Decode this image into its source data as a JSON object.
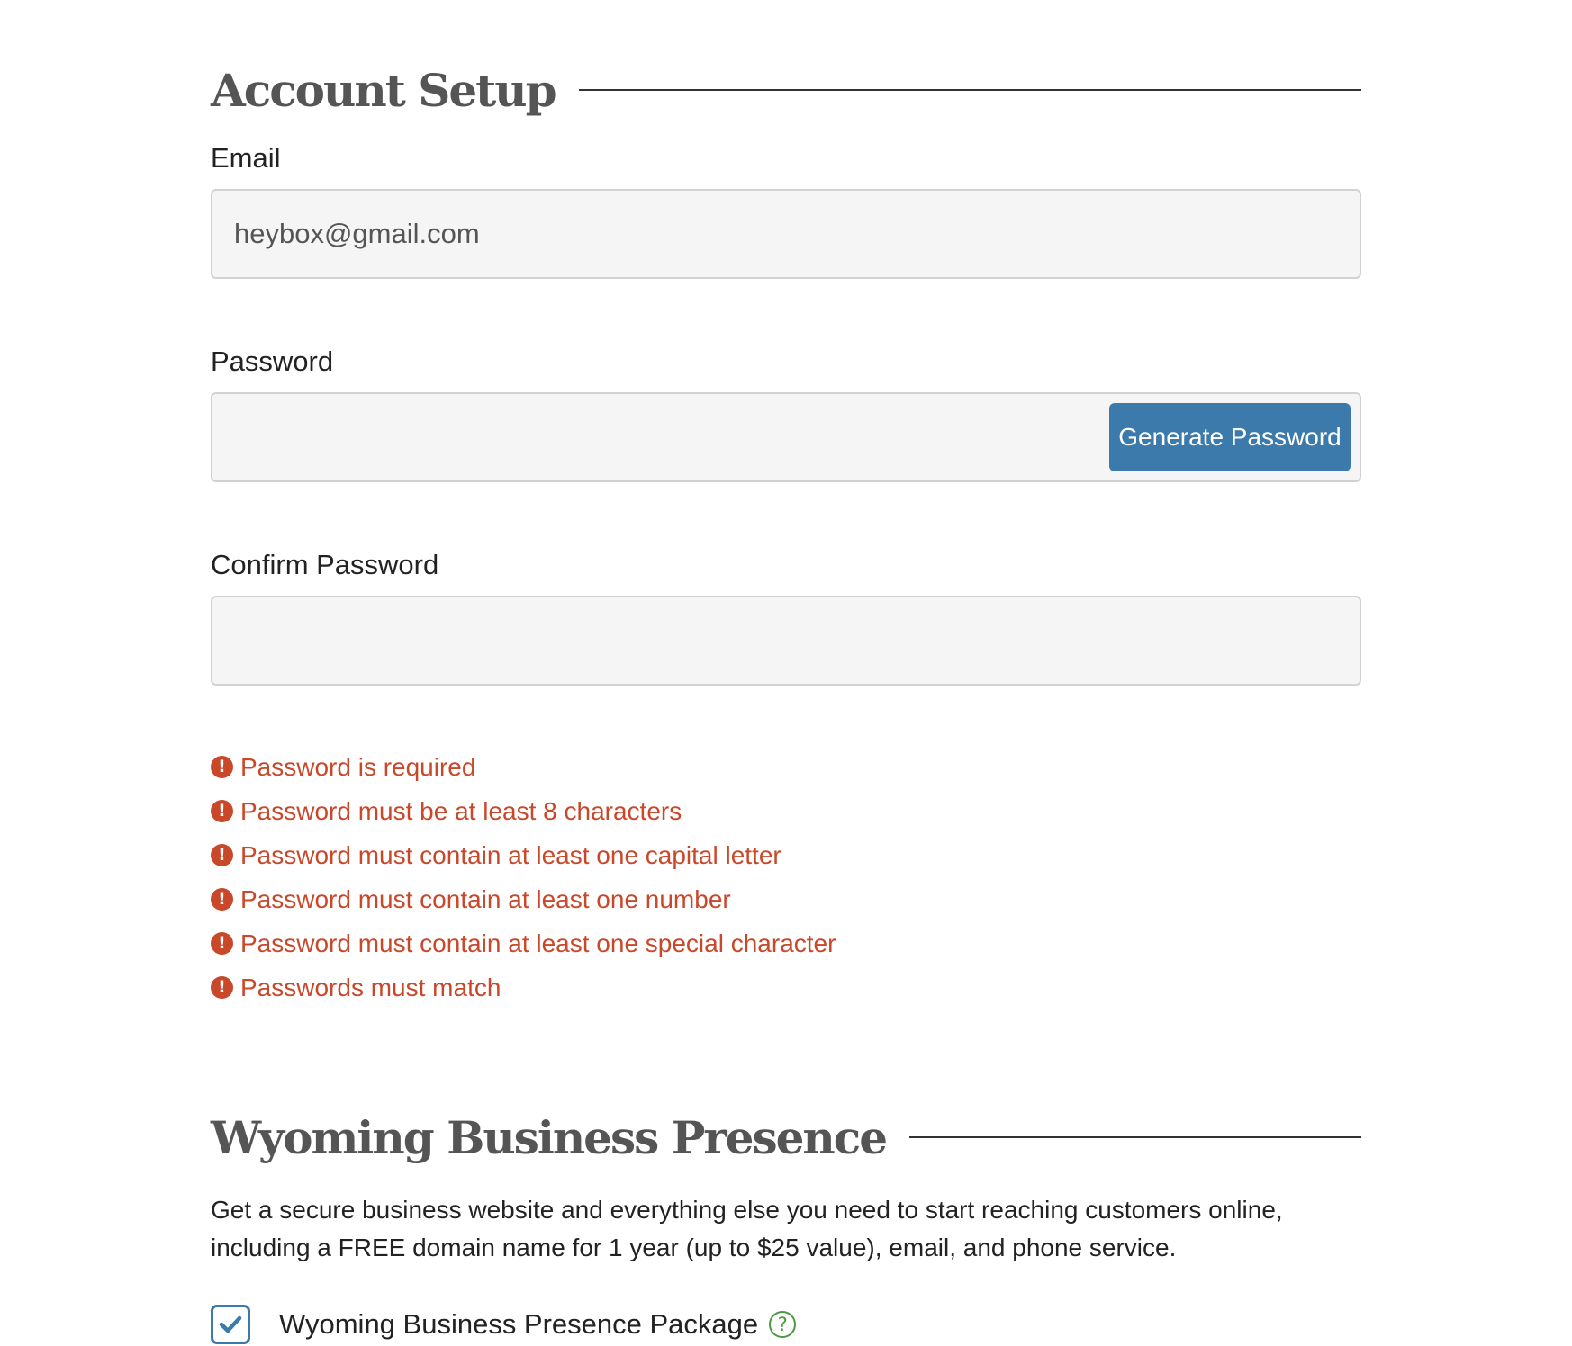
{
  "account_setup": {
    "heading": "Account Setup",
    "email": {
      "label": "Email",
      "value": "heybox@gmail.com"
    },
    "password": {
      "label": "Password",
      "value": "",
      "generate_button_label": "Generate Password"
    },
    "confirm_password": {
      "label": "Confirm Password",
      "value": ""
    },
    "errors": [
      "Password is required",
      "Password must be at least 8 characters",
      "Password must contain at least one capital letter",
      "Password must contain at least one number",
      "Password must contain at least one special character",
      "Passwords must match"
    ],
    "error_icon": "exclamation-circle-icon",
    "error_color": "#c9482a"
  },
  "business_presence": {
    "heading": "Wyoming Business Presence",
    "description": "Get a secure business website and everything else you need to start reaching customers online, including a FREE domain name for 1 year (up to $25 value), email, and phone service.",
    "package": {
      "label": "Wyoming Business Presence Package",
      "checked": true,
      "help_icon": "question-circle-icon"
    }
  },
  "colors": {
    "accent": "#3b7aab",
    "error": "#c9482a",
    "help": "#4a9b3f",
    "heading": "#555555"
  }
}
